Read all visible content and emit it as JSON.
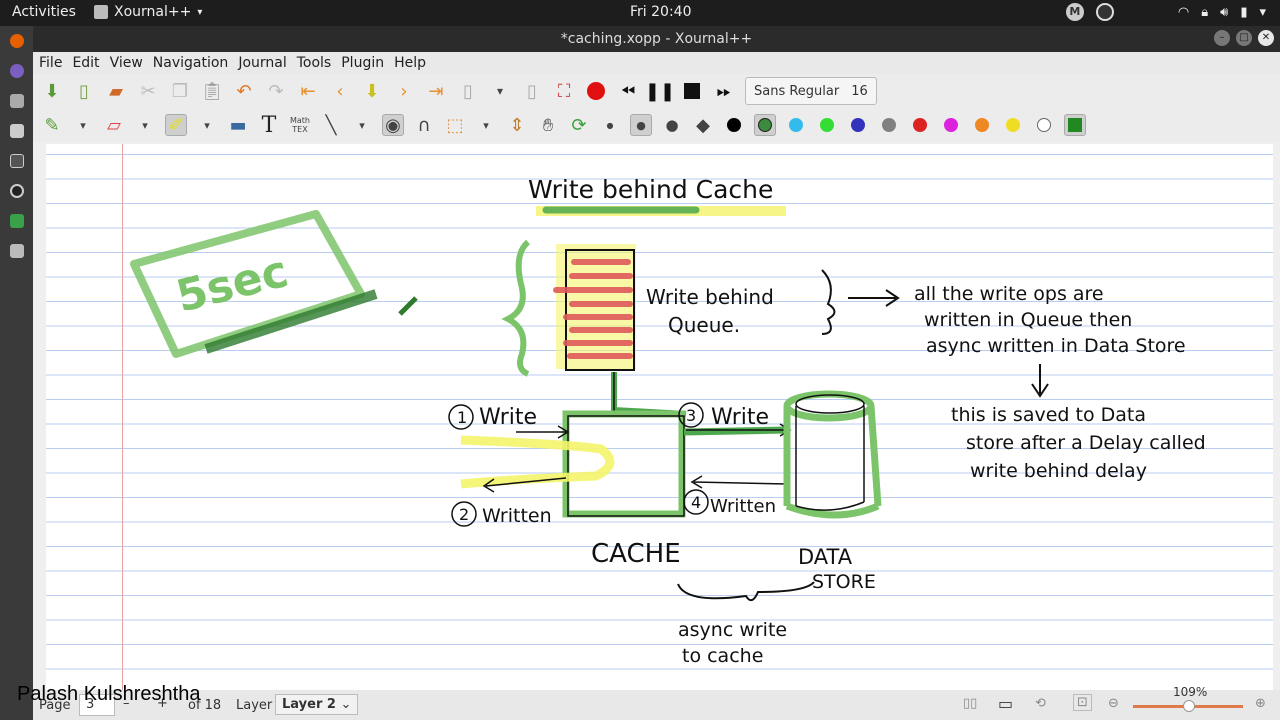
{
  "topbar": {
    "activities": "Activities",
    "app_name": "Xournal++",
    "clock": "Fri 20:40",
    "avatar_letter": "M"
  },
  "window": {
    "title": "*caching.xopp - Xournal++"
  },
  "menu": [
    "File",
    "Edit",
    "View",
    "Navigation",
    "Journal",
    "Tools",
    "Plugin",
    "Help"
  ],
  "toolbar": {
    "font_name": "Sans Regular",
    "font_size": "16",
    "math_label": "Math\nTEX",
    "text_tool_label": "T"
  },
  "colors": {
    "palette": [
      "#000000",
      "#3c8a3c",
      "#33bbee",
      "#33dd33",
      "#3333bb",
      "#808080",
      "#dd2222",
      "#dd22dd",
      "#ee8822",
      "#eedd22",
      "#ffffff",
      "#228822"
    ],
    "accent_green": "#6cbf5b",
    "queue_red": "#e05a5a",
    "highlight_yellow": "#f4f46a"
  },
  "notes": {
    "title": "Write behind Cache",
    "queue_label_1": "Write behind",
    "queue_label_2": "Queue.",
    "sticker": "5sec",
    "explain_1": "all the write ops are",
    "explain_2": "written in Queue then",
    "explain_3": "async written in Data Store",
    "delay_1": "this is saved to Data",
    "delay_2": "store after a Delay called",
    "delay_3": "write behind delay",
    "step1": "Write",
    "step2": "Written",
    "step3": "Write",
    "step4": "Written",
    "n1": "1",
    "n2": "2",
    "n3": "3",
    "n4": "4",
    "cache": "CACHE",
    "data_store_1": "DATA",
    "data_store_2": "STORE",
    "async_1": "async write",
    "async_2": "to cache"
  },
  "status": {
    "page_label": "Page",
    "page_value": "3",
    "of_pages": "of 18",
    "layer_label": "Layer",
    "layer_value": "Layer 2",
    "zoom": "109%"
  },
  "presenter_name": "Palash Kulshreshtha"
}
